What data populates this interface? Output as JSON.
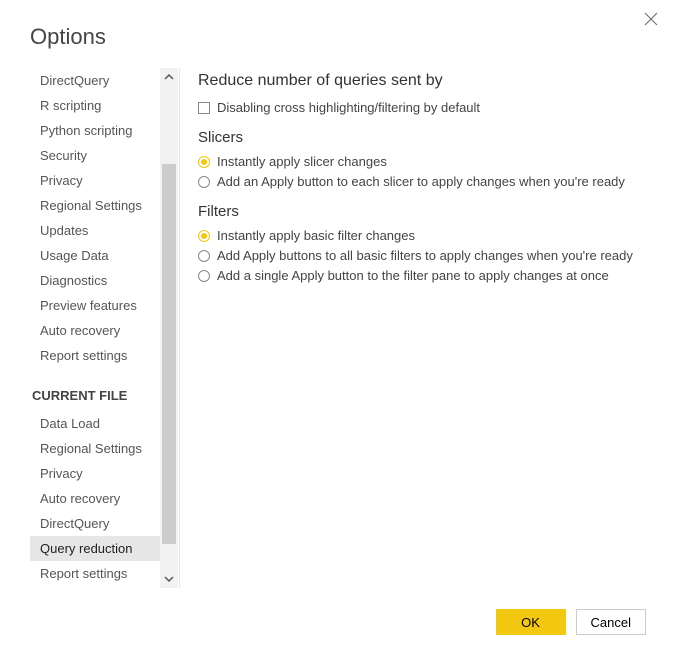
{
  "dialog": {
    "title": "Options"
  },
  "sidebar": {
    "group1_header": "CURRENT FILE",
    "items_top": [
      {
        "label": "DirectQuery"
      },
      {
        "label": "R scripting"
      },
      {
        "label": "Python scripting"
      },
      {
        "label": "Security"
      },
      {
        "label": "Privacy"
      },
      {
        "label": "Regional Settings"
      },
      {
        "label": "Updates"
      },
      {
        "label": "Usage Data"
      },
      {
        "label": "Diagnostics"
      },
      {
        "label": "Preview features"
      },
      {
        "label": "Auto recovery"
      },
      {
        "label": "Report settings"
      }
    ],
    "items_current": [
      {
        "label": "Data Load"
      },
      {
        "label": "Regional Settings"
      },
      {
        "label": "Privacy"
      },
      {
        "label": "Auto recovery"
      },
      {
        "label": "DirectQuery"
      },
      {
        "label": "Query reduction",
        "selected": true
      },
      {
        "label": "Report settings"
      }
    ]
  },
  "content": {
    "section1_title": "Reduce number of queries sent by",
    "checkbox1_label": "Disabling cross highlighting/filtering by default",
    "slicers_title": "Slicers",
    "slicers_options": [
      {
        "label": "Instantly apply slicer changes",
        "selected": true
      },
      {
        "label": "Add an Apply button to each slicer to apply changes when you're ready",
        "selected": false
      }
    ],
    "filters_title": "Filters",
    "filters_options": [
      {
        "label": "Instantly apply basic filter changes",
        "selected": true
      },
      {
        "label": "Add Apply buttons to all basic filters to apply changes when you're ready",
        "selected": false
      },
      {
        "label": "Add a single Apply button to the filter pane to apply changes at once",
        "selected": false
      }
    ]
  },
  "footer": {
    "ok_label": "OK",
    "cancel_label": "Cancel"
  }
}
